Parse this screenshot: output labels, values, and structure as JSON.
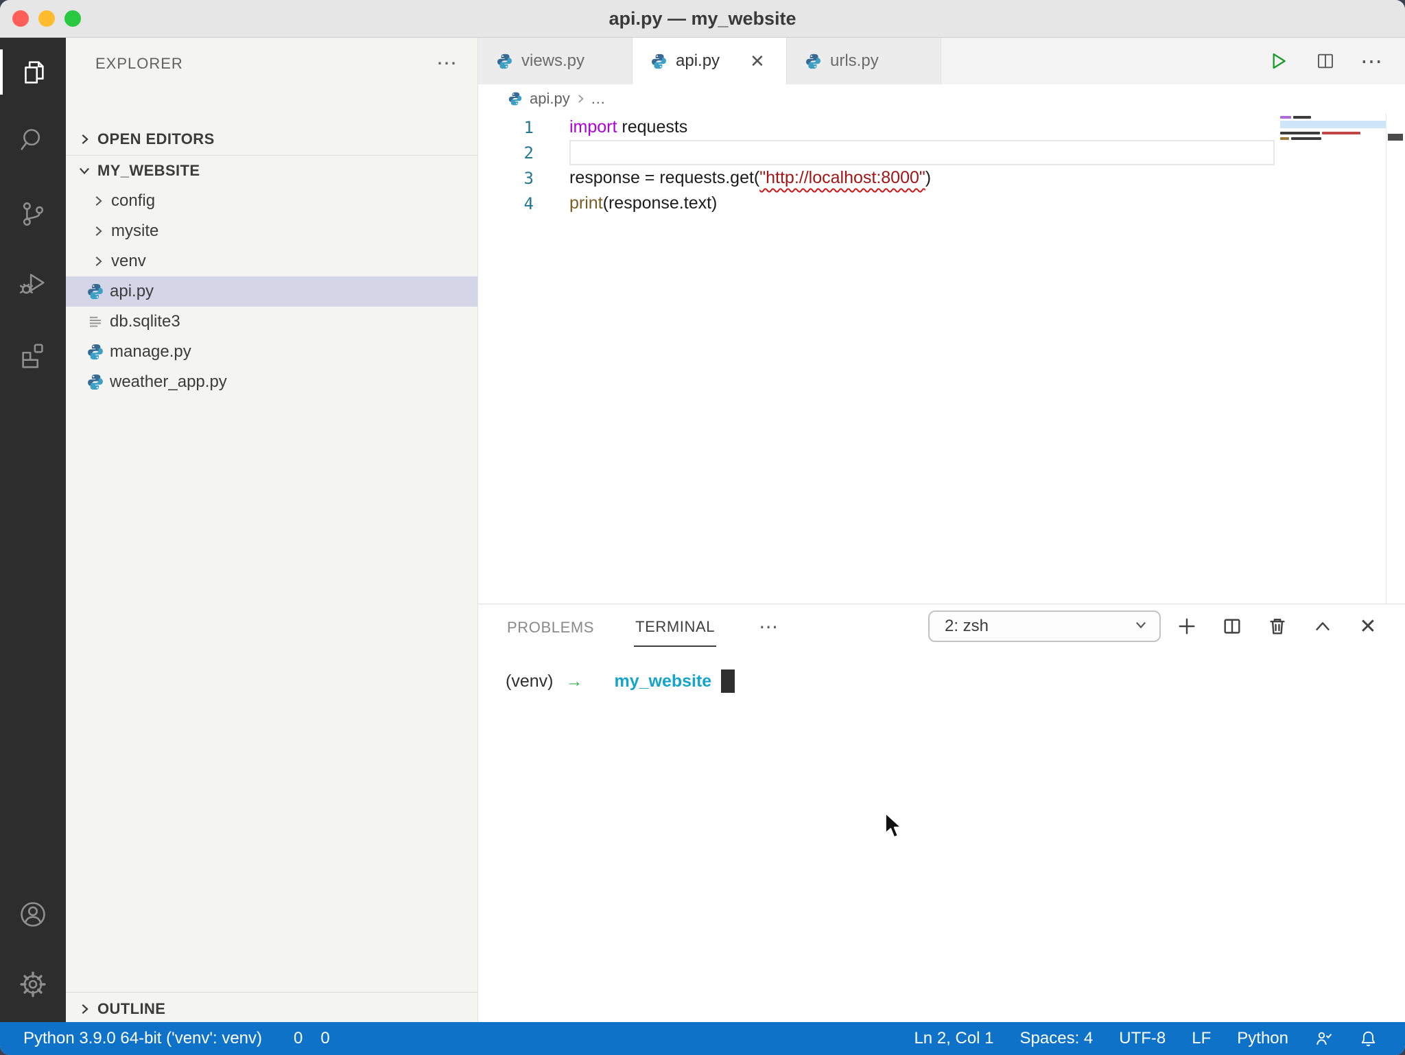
{
  "window": {
    "title": "api.py — my_website"
  },
  "activity_bar": {
    "items": [
      {
        "icon": "files-icon",
        "active": true
      },
      {
        "icon": "search-icon",
        "active": false
      },
      {
        "icon": "source-control-icon",
        "active": false
      },
      {
        "icon": "run-debug-icon",
        "active": false
      },
      {
        "icon": "extensions-icon",
        "active": false
      },
      {
        "icon": "account-icon",
        "active": false
      },
      {
        "icon": "settings-gear-icon",
        "active": false
      }
    ]
  },
  "sidebar": {
    "header": "EXPLORER",
    "header_more": "⋯",
    "open_editors": "OPEN EDITORS",
    "root": "MY_WEBSITE",
    "outline": "OUTLINE",
    "tree": [
      {
        "label": "config",
        "type": "folder"
      },
      {
        "label": "mysite",
        "type": "folder"
      },
      {
        "label": "venv",
        "type": "folder"
      },
      {
        "label": "api.py",
        "type": "python",
        "selected": true
      },
      {
        "label": "db.sqlite3",
        "type": "file"
      },
      {
        "label": "manage.py",
        "type": "python"
      },
      {
        "label": "weather_app.py",
        "type": "python"
      }
    ]
  },
  "editor": {
    "tabs": [
      {
        "label": "views.py",
        "active": false
      },
      {
        "label": "api.py",
        "active": true,
        "close": "✕"
      },
      {
        "label": "urls.py",
        "active": false
      }
    ],
    "actions_more": "⋯",
    "breadcrumb": {
      "file": "api.py",
      "more": "…"
    },
    "code": {
      "lines": [
        {
          "num": "1",
          "tokens": [
            {
              "text": "import",
              "style": "kw"
            },
            {
              "text": " requests",
              "style": "plain"
            }
          ]
        },
        {
          "num": "2",
          "tokens": [],
          "current": true
        },
        {
          "num": "3",
          "tokens": [
            {
              "text": "response = requests.get(",
              "style": "plain"
            },
            {
              "text": "\"http://localhost:8000\"",
              "style": "str-err"
            },
            {
              "text": ")",
              "style": "plain"
            }
          ]
        },
        {
          "num": "4",
          "tokens": [
            {
              "text": "print",
              "style": "fn"
            },
            {
              "text": "(response.text)",
              "style": "plain"
            }
          ]
        }
      ]
    }
  },
  "panel": {
    "tabs": [
      {
        "label": "PROBLEMS",
        "active": false
      },
      {
        "label": "TERMINAL",
        "active": true
      }
    ],
    "more": "⋯",
    "shell_select_value": "2: zsh",
    "panel_close": "✕",
    "terminal": {
      "venv": "(venv)",
      "arrow": "→",
      "cwd": "my_website"
    }
  },
  "status_bar": {
    "python_version": "Python 3.9.0 64-bit ('venv': venv)",
    "errors": "0",
    "warnings": "0",
    "right": [
      {
        "label": "Ln 2, Col 1"
      },
      {
        "label": "Spaces: 4"
      },
      {
        "label": "UTF-8"
      },
      {
        "label": "LF"
      },
      {
        "label": "Python"
      }
    ]
  },
  "colors": {
    "status_bar": "#0e72c8",
    "keyword": "#af00db",
    "string": "#a31515",
    "function": "#795e26",
    "selection": "#d4d6e8",
    "terminal_cyan": "#14a5c9",
    "terminal_green": "#35b44a"
  }
}
